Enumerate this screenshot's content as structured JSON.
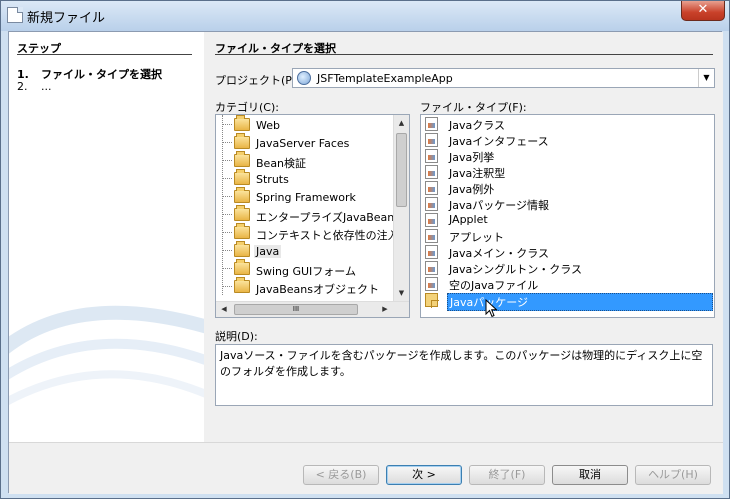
{
  "window": {
    "title": "新規ファイル",
    "close_glyph": "✕"
  },
  "steps": {
    "header": "ステップ",
    "items": [
      {
        "num": "1.",
        "label": "ファイル・タイプを選択"
      },
      {
        "num": "2.",
        "label": "..."
      }
    ]
  },
  "main": {
    "header": "ファイル・タイプを選択",
    "project_label": "プロジェクト(P):",
    "project_value": "JSFTemplateExampleApp",
    "category_label": "カテゴリ(C):",
    "filetype_label": "ファイル・タイプ(F):",
    "categories": [
      "Web",
      "JavaServer Faces",
      "Bean検証",
      "Struts",
      "Spring Framework",
      "エンタープライズJavaBeans",
      "コンテキストと依存性の注入",
      "Java",
      "Swing GUIフォーム",
      "JavaBeansオブジェクト"
    ],
    "selected_category": "Java",
    "file_types": [
      "Javaクラス",
      "Javaインタフェース",
      "Java列挙",
      "Java注釈型",
      "Java例外",
      "Javaパッケージ情報",
      "JApplet",
      "アプレット",
      "Javaメイン・クラス",
      "Javaシングルトン・クラス",
      "空のJavaファイル",
      "Javaパッケージ"
    ],
    "selected_file_type": "Javaパッケージ",
    "scroll_grip": "III",
    "description_label": "説明(D):",
    "description": "Javaソース・ファイルを含むパッケージを作成します。このパッケージは物理的にディスク上に空のフォルダを作成します。"
  },
  "footer": {
    "back": "< 戻る(B)",
    "next": "次 >",
    "finish": "終了(F)",
    "cancel": "取消",
    "help": "ヘルプ(H)"
  }
}
